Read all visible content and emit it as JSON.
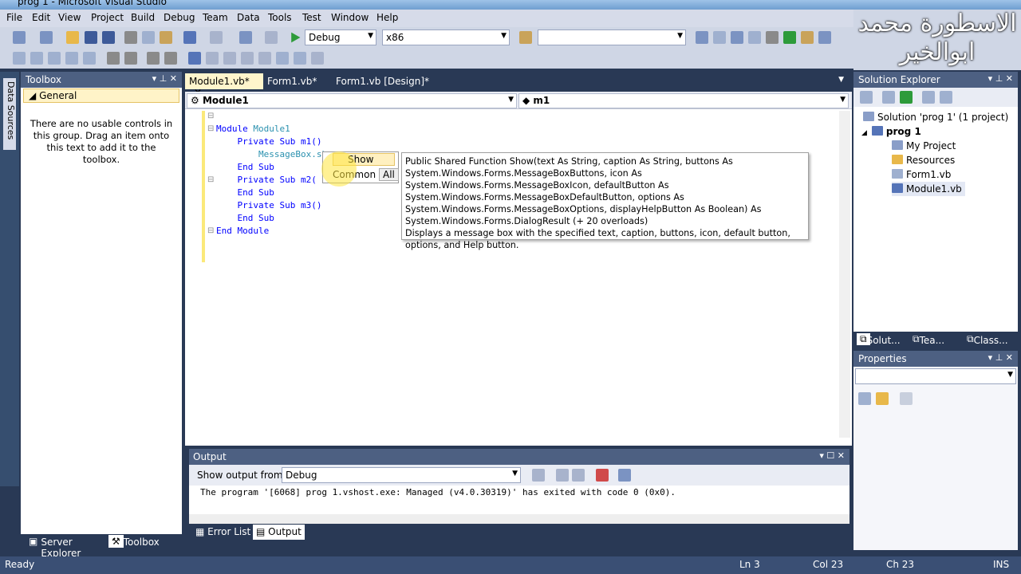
{
  "window": {
    "title": "prog 1 - Microsoft Visual Studio"
  },
  "menu": [
    "File",
    "Edit",
    "View",
    "Project",
    "Build",
    "Debug",
    "Team",
    "Data",
    "Tools",
    "Test",
    "Window",
    "Help"
  ],
  "toolbar": {
    "config": "Debug",
    "platform": "x86",
    "find": ""
  },
  "logo_text": "الاسطورة محمد ابوالخير",
  "toolbox": {
    "title": "Toolbox",
    "group": "General",
    "empty_message": "There are no usable controls in this group. Drag an item onto this text to add it to the toolbox.",
    "tab_server": "Server Explorer",
    "tab_toolbox": "Toolbox",
    "data_sources": "Data Sources"
  },
  "doc_tabs": [
    "Module1.vb*",
    "Form1.vb*",
    "Form1.vb [Design]*"
  ],
  "editor": {
    "nav_left": "Module1",
    "nav_right": "m1",
    "lines": {
      "l1a": "Module ",
      "l1b": "Module1",
      "l2": "    Private Sub m1()",
      "l3": "        MessageBox.sho",
      "l4": "    End Sub",
      "l5": "",
      "l6": "    Private Sub m2(",
      "l7": "",
      "l8": "    End Sub",
      "l9": "",
      "l10": "    Private Sub m3()",
      "l11": "",
      "l12": "    End Sub",
      "l13": "End Module"
    }
  },
  "intellisense": {
    "item": "Show",
    "tab_common": "Common",
    "tab_all": "All"
  },
  "tooltip": {
    "signature": "Public Shared Function Show(text As String, caption As String, buttons As System.Windows.Forms.MessageBoxButtons, icon As System.Windows.Forms.MessageBoxIcon, defaultButton As System.Windows.Forms.MessageBoxDefaultButton, options As System.Windows.Forms.MessageBoxOptions, displayHelpButton As Boolean) As System.Windows.Forms.DialogResult (+ 20 overloads)",
    "description": "Displays a message box with the specified text, caption, buttons, icon, default button, options, and Help button."
  },
  "output": {
    "title": "Output",
    "show_from_label": "Show output from:",
    "source": "Debug",
    "text": "The program '[6068] prog 1.vshost.exe: Managed (v4.0.30319)' has exited with code 0 (0x0).",
    "tab_errors": "Error List",
    "tab_output": "Output"
  },
  "solution_explorer": {
    "title": "Solution Explorer",
    "solution": "Solution 'prog 1' (1 project)",
    "project": "prog 1",
    "items": [
      "My Project",
      "Resources",
      "Form1.vb",
      "Module1.vb"
    ],
    "tabs": [
      "Solut...",
      "Tea...",
      "Class..."
    ]
  },
  "properties": {
    "title": "Properties"
  },
  "status": {
    "state": "Ready",
    "ln": "Ln 3",
    "col": "Col 23",
    "ch": "Ch 23",
    "mode": "INS"
  }
}
